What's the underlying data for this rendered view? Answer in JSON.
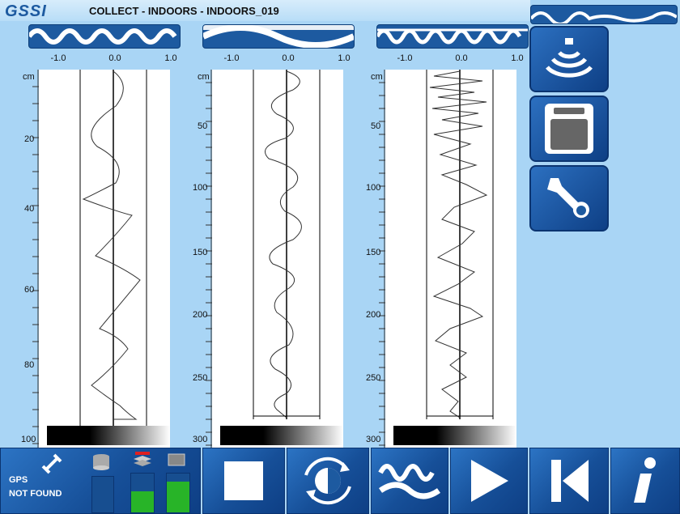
{
  "app": {
    "logo_text": "GSSI",
    "title": "COLLECT - INDOORS - INDOORS_019"
  },
  "scale_labels": [
    "-1.0",
    "0.0",
    "1.0"
  ],
  "panels": [
    {
      "unit": "cm",
      "depth_labels": [
        "20",
        "40",
        "60",
        "80",
        "100"
      ]
    },
    {
      "unit": "cm",
      "depth_labels": [
        "50",
        "100",
        "150",
        "200",
        "250",
        "300"
      ]
    },
    {
      "unit": "cm",
      "depth_labels": [
        "50",
        "100",
        "150",
        "200",
        "250",
        "300"
      ]
    }
  ],
  "side_buttons": [
    {
      "icon": "antenna-signal-icon"
    },
    {
      "icon": "storage-device-icon"
    },
    {
      "icon": "wrench-icon"
    }
  ],
  "status": {
    "gps_label": "GPS",
    "gps_state": "NOT FOUND",
    "battery_level_1": 0.55,
    "battery_level_2": 0.8
  },
  "toolbar": {
    "stop": "stop-icon",
    "refresh": "cycle-icon",
    "filter": "wave-filter-icon",
    "play": "play-icon",
    "back": "skip-back-icon",
    "info": "info-icon"
  },
  "colors": {
    "accent": "#1d5aa0",
    "background": "#a9d5f5",
    "battery": "#28b428"
  }
}
